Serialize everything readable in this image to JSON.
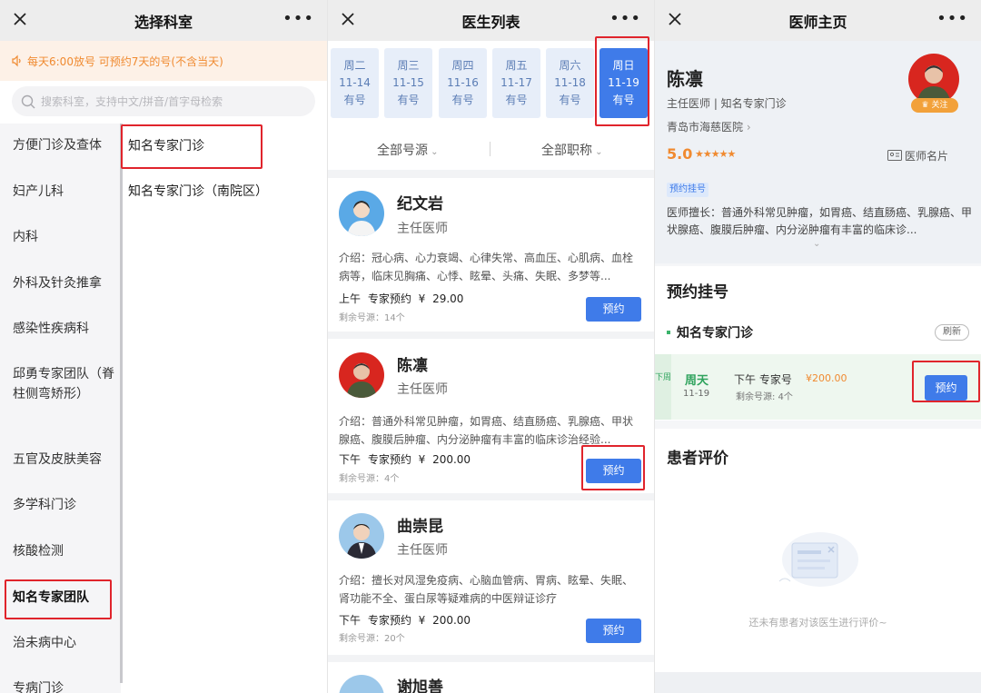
{
  "panel1": {
    "title": "选择科室",
    "notice": "每天6:00放号 可预约7天的号(不含当天)",
    "search_placeholder": "搜索科室，支持中文/拼音/首字母检索",
    "departments": [
      "方便门诊及查体",
      "妇产儿科",
      "内科",
      "外科及针灸推拿",
      "感染性疾病科",
      "邱勇专家团队（脊柱侧弯矫形）",
      "五官及皮肤美容",
      "多学科门诊",
      "核酸检测",
      "知名专家团队",
      "治未病中心",
      "专病门诊"
    ],
    "sub_departments": [
      "知名专家门诊",
      "知名专家门诊（南院区）"
    ]
  },
  "panel2": {
    "title": "医生列表",
    "days": [
      {
        "week": "周二",
        "date": "11-14",
        "status": "有号"
      },
      {
        "week": "周三",
        "date": "11-15",
        "status": "有号"
      },
      {
        "week": "周四",
        "date": "11-16",
        "status": "有号"
      },
      {
        "week": "周五",
        "date": "11-17",
        "status": "有号"
      },
      {
        "week": "周六",
        "date": "11-18",
        "status": "有号"
      },
      {
        "week": "周日",
        "date": "11-19",
        "status": "有号"
      }
    ],
    "filter_source": "全部号源",
    "filter_title": "全部职称",
    "doctors": [
      {
        "name": "纪文岩",
        "title": "主任医师",
        "intro": "介绍：冠心病、心力衰竭、心律失常、高血压、心肌病、血栓病等，临床见胸痛、心悸、眩晕、头痛、失眠、多梦等...",
        "slot": "上午 专家预约 ¥ 29.00",
        "remain": "剩余号源：14个",
        "button": "预约"
      },
      {
        "name": "陈凛",
        "title": "主任医师",
        "intro": "介绍：普通外科常见肿瘤，如胃癌、结直肠癌、乳腺癌、甲状腺癌、腹膜后肿瘤、内分泌肿瘤有丰富的临床诊治经验...",
        "slot": "下午 专家预约 ¥ 200.00",
        "remain": "剩余号源：4个",
        "button": "预约"
      },
      {
        "name": "曲崇昆",
        "title": "主任医师",
        "intro": "介绍：擅长对风湿免疫病、心脑血管病、胃病、眩晕、失眠、肾功能不全、蛋白尿等疑难病的中医辩证诊疗",
        "slot": "下午 专家预约 ¥ 200.00",
        "remain": "剩余号源：20个",
        "button": "预约"
      },
      {
        "name": "谢旭善",
        "title": "",
        "intro": "",
        "slot": "",
        "remain": "",
        "button": ""
      }
    ]
  },
  "panel3": {
    "title": "医师主页",
    "name": "陈凛",
    "subtitle": "主任医师 | 知名专家门诊",
    "hospital": "青岛市海慈医院",
    "score": "5.0",
    "stars": "★★★★★",
    "card_label": "医师名片",
    "follow": "关注",
    "tag": "预约挂号",
    "skill": "医师擅长：普通外科常见肿瘤，如胃癌、结直肠癌、乳腺癌、甲状腺癌、腹膜后肿瘤、内分泌肿瘤有丰富的临床诊...",
    "section_booking": "预约挂号",
    "clinic": "知名专家门诊",
    "refresh": "刷新",
    "slot_tag": "下周",
    "slot_day": "周天",
    "slot_date": "11-19",
    "slot_type": "下午 专家号",
    "slot_price": "¥200.00",
    "slot_remain": "剩余号源: 4个",
    "slot_button": "预约",
    "section_review": "患者评价",
    "empty_review": "还未有患者对该医生进行评价~"
  }
}
